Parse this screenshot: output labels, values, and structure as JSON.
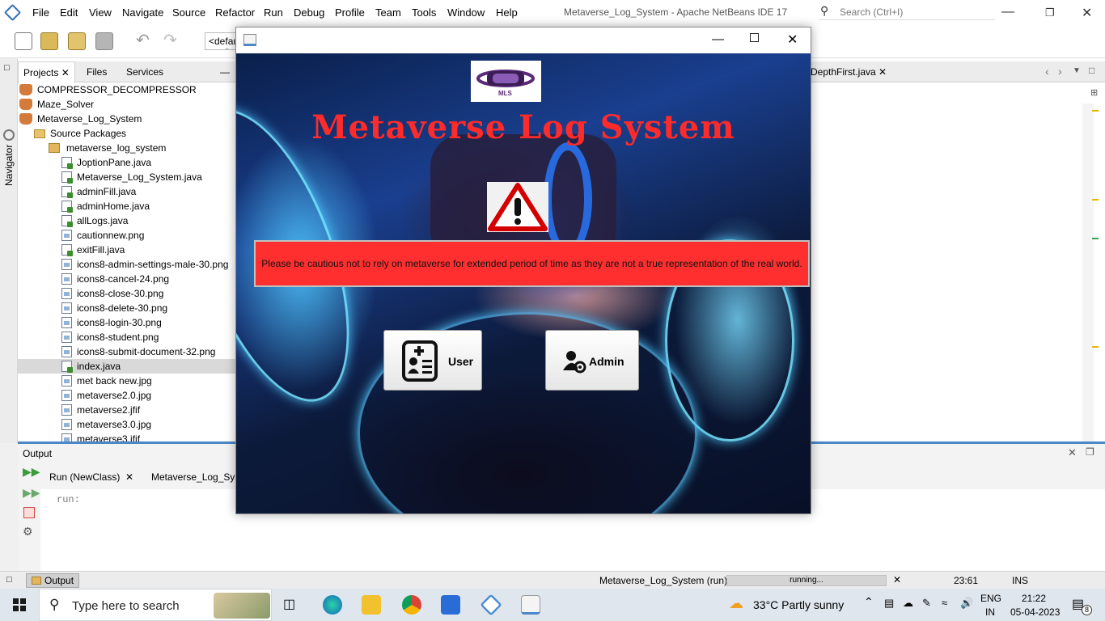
{
  "ide": {
    "menu": [
      "File",
      "Edit",
      "View",
      "Navigate",
      "Source",
      "Refactor",
      "Run",
      "Debug",
      "Profile",
      "Team",
      "Tools",
      "Window",
      "Help"
    ],
    "title": "Metaverse_Log_System - Apache NetBeans IDE 17",
    "search_placeholder": "Search (Ctrl+I)",
    "config_value": "<default config>",
    "navigator_label": "Navigator"
  },
  "projects": {
    "tabs": [
      "Projects",
      "Files",
      "Services"
    ],
    "projects": [
      "COMPRESSOR_DECOMPRESSOR",
      "Maze_Solver",
      "Metaverse_Log_System"
    ],
    "source_packages": "Source Packages",
    "package": "metaverse_log_system",
    "files": [
      "JoptionPane.java",
      "Metaverse_Log_System.java",
      "adminFill.java",
      "adminHome.java",
      "allLogs.java",
      "cautionnew.png",
      "exitFill.java",
      "icons8-admin-settings-male-30.png",
      "icons8-cancel-24.png",
      "icons8-close-30.png",
      "icons8-delete-30.png",
      "icons8-login-30.png",
      "icons8-student.png",
      "icons8-submit-document-32.png",
      "index.java",
      "met back new.jpg",
      "metaverse2.0.jpg",
      "metaverse2.jfif",
      "metaverse3.0.jpg",
      "metaverse3.jfif"
    ],
    "selected": "index.java"
  },
  "editor": {
    "tab": "DepthFirst.java"
  },
  "output": {
    "title": "Output",
    "tabs": [
      "Run (NewClass)",
      "Metaverse_Log_System (run)"
    ],
    "text": "run:"
  },
  "status": {
    "tab": "Output",
    "task": "Metaverse_Log_System (run)",
    "progress_text": "running...",
    "position": "23:61",
    "mode": "INS"
  },
  "app": {
    "logo_text": "MLS",
    "heading": "Metaverse Log System",
    "caution": "Please be cautious not to rely on metaverse for extended period of time as they are not a true representation of the real world.",
    "user_button": "User",
    "admin_button": "Admin",
    "accent_red": "#ff2b2b"
  },
  "taskbar": {
    "search_placeholder": "Type here to search",
    "weather": "33°C  Partly sunny",
    "lang": "ENG",
    "region": "IN",
    "time": "21:22",
    "date": "05-04-2023",
    "notifications": "8"
  }
}
